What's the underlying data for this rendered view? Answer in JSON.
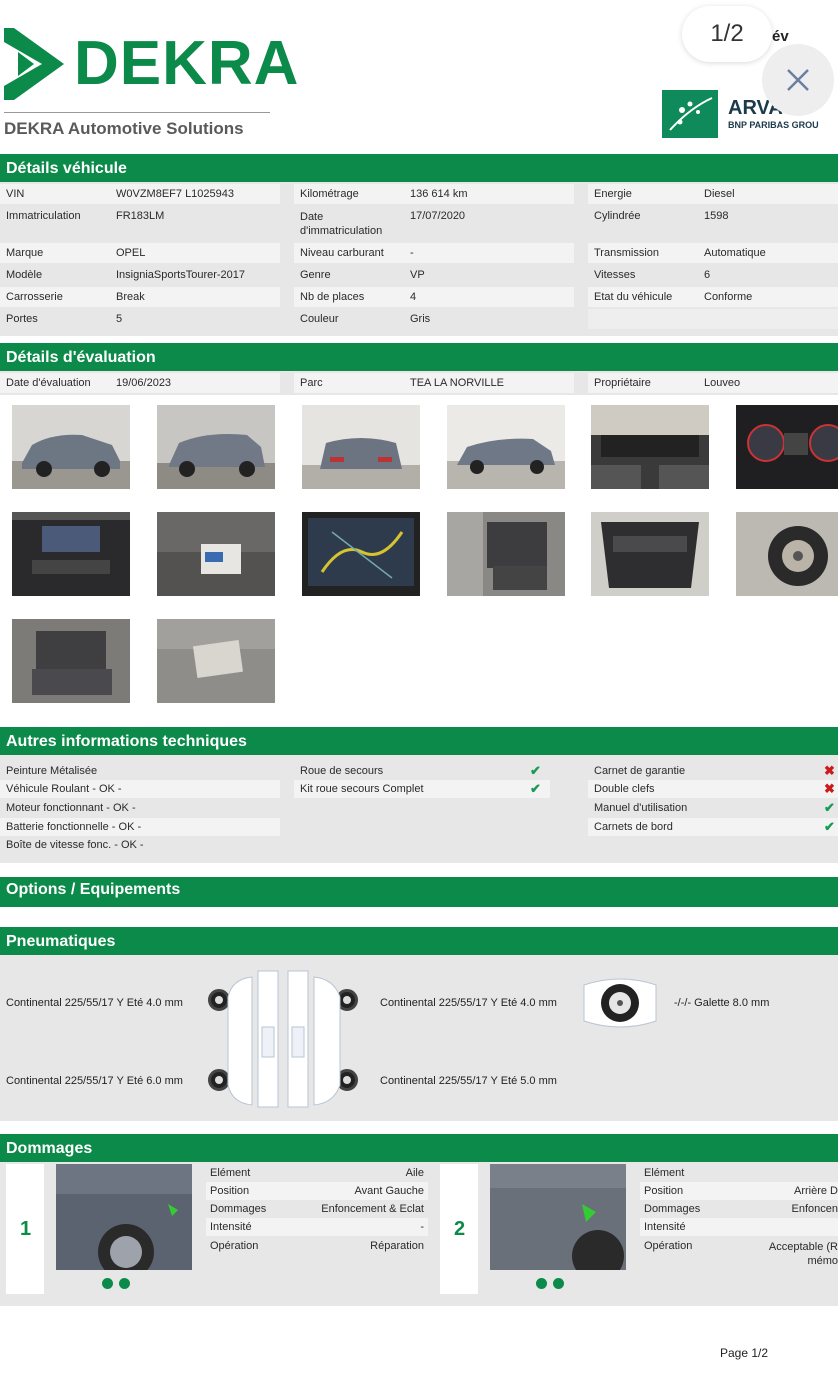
{
  "header": {
    "brand": "DEKRA",
    "brand_sub": "DEKRA Automotive Solutions",
    "page_counter": "1/2",
    "top_right_fragment": "év",
    "partner_name": "ARVA",
    "partner_group": "BNP PARIBAS GROU"
  },
  "vehicle": {
    "title": "Détails véhicule",
    "col1": [
      {
        "k": "VIN",
        "v": "W0VZM8EF7 L1025943"
      },
      {
        "k": "Immatriculation",
        "v": "FR183LM"
      },
      {
        "k": "Marque",
        "v": "OPEL"
      },
      {
        "k": "Modèle",
        "v": "InsigniaSportsTourer-2017"
      },
      {
        "k": "Carrosserie",
        "v": "Break"
      },
      {
        "k": "Portes",
        "v": "5"
      }
    ],
    "col2": [
      {
        "k": "Kilométrage",
        "v": "136 614 km"
      },
      {
        "k": "Date",
        "k2": "d'immatriculation",
        "v": "17/07/2020"
      },
      {
        "k": "Niveau carburant",
        "v": "-"
      },
      {
        "k": "Genre",
        "v": "VP"
      },
      {
        "k": "Nb de places",
        "v": "4"
      },
      {
        "k": "Couleur",
        "v": "Gris"
      }
    ],
    "col3": [
      {
        "k": "Energie",
        "v": "Diesel"
      },
      {
        "k": "Cylindrée",
        "v": "1598"
      },
      {
        "k": "Transmission",
        "v": "Automatique"
      },
      {
        "k": "Vitesses",
        "v": "6"
      },
      {
        "k": "Etat du véhicule",
        "v": "Conforme"
      }
    ]
  },
  "evaluation": {
    "title": "Détails d'évaluation",
    "fields": [
      {
        "k": "Date d'évaluation",
        "v": "19/06/2023"
      },
      {
        "k": "Parc",
        "v": "TEA LA NORVILLE"
      },
      {
        "k": "Propriétaire",
        "v": "Louveo"
      }
    ],
    "photos": [
      "front-left",
      "rear-left",
      "rear",
      "front-right",
      "dashboard",
      "instrument-cluster",
      "center-console",
      "seat-tag",
      "navigation-screen",
      "front-seats",
      "trunk",
      "spare-wheel",
      "rear-seats",
      "trunk-label"
    ]
  },
  "tech": {
    "title": "Autres informations techniques",
    "col1": [
      "Peinture Métalisée",
      "Véhicule Roulant - OK -",
      "Moteur fonctionnant - OK -",
      "Batterie fonctionnelle - OK -",
      "Boîte de vitesse fonc. - OK -"
    ],
    "col2": [
      {
        "label": "Roue de secours",
        "status": "check"
      },
      {
        "label": "Kit roue secours Complet",
        "status": "check"
      }
    ],
    "col3": [
      {
        "label": "Carnet de garantie",
        "status": "cross"
      },
      {
        "label": "Double clefs",
        "status": "cross"
      },
      {
        "label": "Manuel d'utilisation",
        "status": "check"
      },
      {
        "label": "Carnets de bord",
        "status": "check"
      }
    ]
  },
  "options": {
    "title": "Options / Equipements"
  },
  "tyres": {
    "title": "Pneumatiques",
    "front_left": "Continental 225/55/17 Y Eté 4.0 mm",
    "front_right": "Continental 225/55/17 Y Eté 4.0 mm",
    "rear_left": "Continental 225/55/17 Y Eté 6.0 mm",
    "rear_right": "Continental 225/55/17 Y Eté 5.0 mm",
    "spare": "-/-/-  Galette 8.0 mm"
  },
  "damages": {
    "title": "Dommages",
    "items": [
      {
        "num": "1",
        "rows": [
          {
            "k": "Elément",
            "v": "Aile"
          },
          {
            "k": "Position",
            "v": "Avant Gauche"
          },
          {
            "k": "Dommages",
            "v": "Enfoncement & Eclat"
          },
          {
            "k": "Intensité",
            "v": "-"
          },
          {
            "k": "Opération",
            "v": "Réparation"
          }
        ]
      },
      {
        "num": "2",
        "rows": [
          {
            "k": "Elément",
            "v": ""
          },
          {
            "k": "Position",
            "v": "Arrière D"
          },
          {
            "k": "Dommages",
            "v": "Enfoncen"
          },
          {
            "k": "Intensité",
            "v": ""
          },
          {
            "k": "Opération",
            "v": "Acceptable (R",
            "v2": "mémo"
          }
        ]
      }
    ]
  },
  "footer": {
    "page": "Page 1/2"
  },
  "colors": {
    "accent": "#0b8a4a",
    "panel": "#e7e7e7",
    "check": "#1a9a55",
    "cross": "#cc1a1a"
  }
}
